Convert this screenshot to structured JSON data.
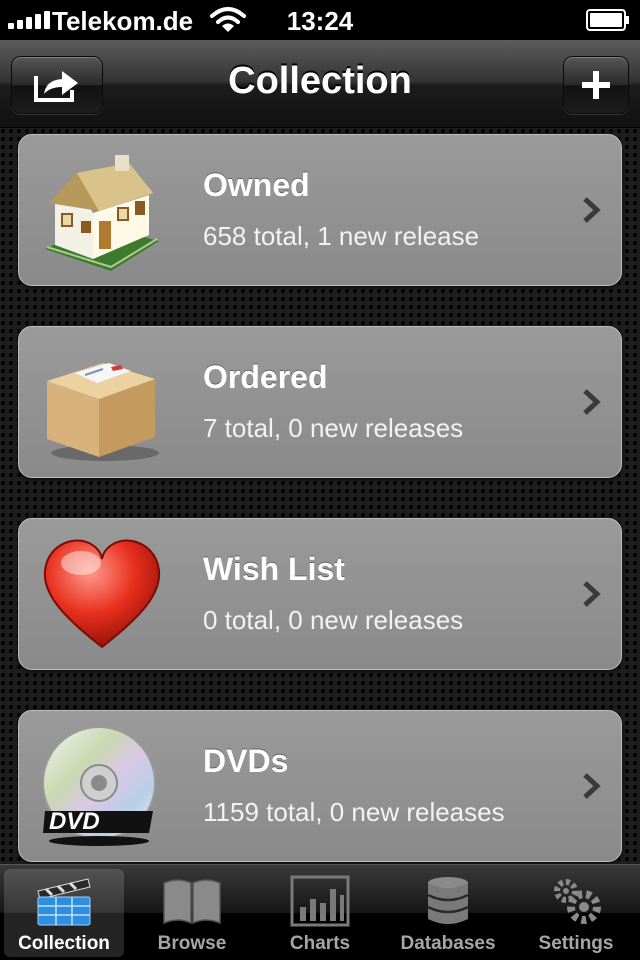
{
  "status": {
    "carrier": "Telekom.de",
    "time": "13:24"
  },
  "nav": {
    "title": "Collection",
    "left_button_icon": "share-icon",
    "right_button_icon": "plus-icon"
  },
  "cards": [
    {
      "icon": "house-icon",
      "title": "Owned",
      "subtitle": "658 total, 1 new release"
    },
    {
      "icon": "package-icon",
      "title": "Ordered",
      "subtitle": "7 total, 0 new releases"
    },
    {
      "icon": "heart-icon",
      "title": "Wish List",
      "subtitle": "0 total, 0 new releases"
    },
    {
      "icon": "dvd-icon",
      "title": "DVDs",
      "subtitle": "1159 total, 0 new releases"
    }
  ],
  "tabs": [
    {
      "icon": "clapperboard-icon",
      "label": "Collection",
      "active": true
    },
    {
      "icon": "book-icon",
      "label": "Browse",
      "active": false
    },
    {
      "icon": "bar-chart-icon",
      "label": "Charts",
      "active": false
    },
    {
      "icon": "database-icon",
      "label": "Databases",
      "active": false
    },
    {
      "icon": "gears-icon",
      "label": "Settings",
      "active": false
    }
  ]
}
